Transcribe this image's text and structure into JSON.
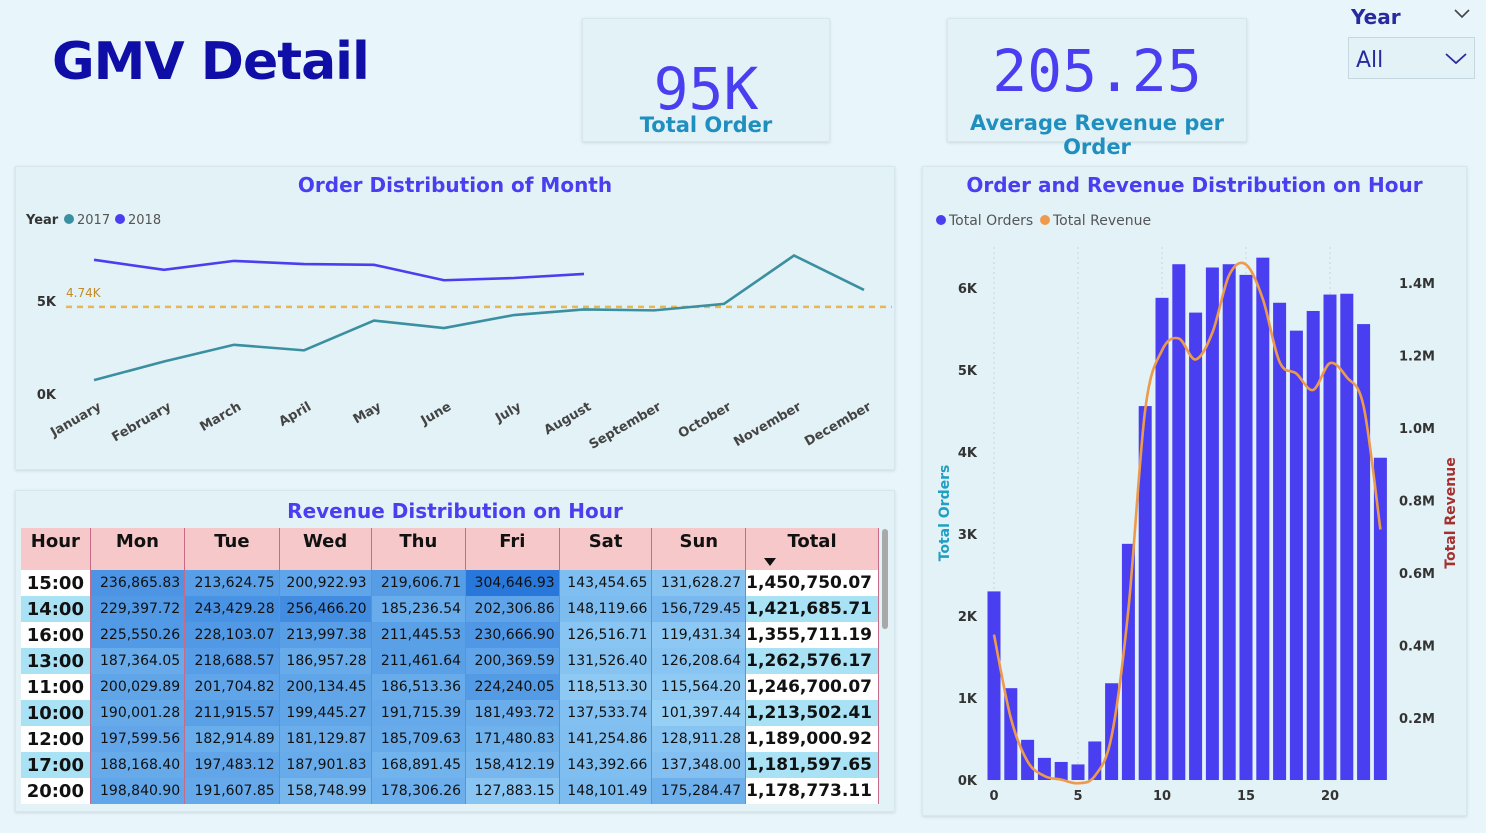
{
  "page_title": "GMV Detail",
  "kpis": {
    "total_order_value": "95K",
    "total_order_label": "Total Order",
    "avg_revenue_value": "205.25",
    "avg_revenue_label": "Average Revenue per Order"
  },
  "slicer": {
    "title": "Year",
    "selected": "All"
  },
  "colors": {
    "series_2017": "#3a8fa0",
    "series_2018": "#4a3ff0",
    "bar": "#4a3ff0",
    "revenue_line": "#ee9a4d",
    "avg_line": "#e8b84f",
    "header_pink": "#f6c8c9",
    "title_blue": "#0f0fa8"
  },
  "month_chart": {
    "title": "Order Distribution of Month",
    "legend_title": "Year",
    "avg_label": "4.74K"
  },
  "hour_chart": {
    "title": "Order and Revenue Distribution on Hour",
    "left_axis_label": "Total Orders",
    "right_axis_label": "Total Revenue"
  },
  "matrix": {
    "title": "Revenue Distribution on Hour",
    "headers": [
      "Hour",
      "Mon",
      "Tue",
      "Wed",
      "Thu",
      "Fri",
      "Sat",
      "Sun",
      "Total"
    ],
    "rows": [
      [
        "15:00",
        "236,865.83",
        "213,624.75",
        "200,922.93",
        "219,606.71",
        "304,646.93",
        "143,454.65",
        "131,628.27",
        "1,450,750.07"
      ],
      [
        "14:00",
        "229,397.72",
        "243,429.28",
        "256,466.20",
        "185,236.54",
        "202,306.86",
        "148,119.66",
        "156,729.45",
        "1,421,685.71"
      ],
      [
        "16:00",
        "225,550.26",
        "228,103.07",
        "213,997.38",
        "211,445.53",
        "230,666.90",
        "126,516.71",
        "119,431.34",
        "1,355,711.19"
      ],
      [
        "13:00",
        "187,364.05",
        "218,688.57",
        "186,957.28",
        "211,461.64",
        "200,369.59",
        "131,526.40",
        "126,208.64",
        "1,262,576.17"
      ],
      [
        "11:00",
        "200,029.89",
        "201,704.82",
        "200,134.45",
        "186,513.36",
        "224,240.05",
        "118,513.30",
        "115,564.20",
        "1,246,700.07"
      ],
      [
        "10:00",
        "190,001.28",
        "211,915.57",
        "199,445.27",
        "191,715.39",
        "181,493.72",
        "137,533.74",
        "101,397.44",
        "1,213,502.41"
      ],
      [
        "12:00",
        "197,599.56",
        "182,914.89",
        "181,129.87",
        "185,709.63",
        "171,480.83",
        "141,254.86",
        "128,911.28",
        "1,189,000.92"
      ],
      [
        "17:00",
        "188,168.40",
        "197,483.12",
        "187,901.83",
        "168,891.45",
        "158,412.19",
        "143,392.66",
        "137,348.00",
        "1,181,597.65"
      ],
      [
        "20:00",
        "198,840.90",
        "191,607.85",
        "158,748.99",
        "178,306.26",
        "127,883.15",
        "148,101.49",
        "175,284.47",
        "1,178,773.11"
      ]
    ]
  },
  "chart_data": [
    {
      "type": "line",
      "title": "Order Distribution of Month",
      "legend_title": "Year",
      "legend_position": "top-left",
      "categories": [
        "January",
        "February",
        "March",
        "April",
        "May",
        "June",
        "July",
        "August",
        "September",
        "October",
        "November",
        "December"
      ],
      "y_ticks": [
        "0K",
        "5K"
      ],
      "ylim": [
        0,
        7500
      ],
      "reference_line": {
        "value": 4740,
        "label": "4.74K"
      },
      "series": [
        {
          "name": "2017",
          "values": [
            800,
            1800,
            2700,
            2400,
            4000,
            3600,
            4300,
            4600,
            4550,
            4900,
            7500,
            5650
          ]
        },
        {
          "name": "2018",
          "values": [
            7270,
            6730,
            7210,
            7040,
            7000,
            6170,
            6290,
            6510
          ]
        }
      ]
    },
    {
      "type": "bar",
      "title": "Order and Revenue Distribution on Hour",
      "legend_position": "top-left",
      "x": [
        0,
        1,
        2,
        3,
        4,
        5,
        6,
        7,
        8,
        9,
        10,
        11,
        12,
        13,
        14,
        15,
        16,
        17,
        18,
        19,
        20,
        21,
        22,
        23
      ],
      "x_ticks": [
        0,
        5,
        10,
        15,
        20
      ],
      "y_left_ticks": [
        "0K",
        "1K",
        "2K",
        "3K",
        "4K",
        "5K",
        "6K"
      ],
      "y_right_ticks": [
        "0.2M",
        "0.4M",
        "0.6M",
        "0.8M",
        "1.0M",
        "1.2M",
        "1.4M"
      ],
      "ylim_left": [
        0,
        6500
      ],
      "ylim_right": [
        0,
        1510000
      ],
      "series": [
        {
          "name": "Total Orders",
          "kind": "bar",
          "axis": "left",
          "values": [
            2300,
            1120,
            490,
            270,
            220,
            190,
            470,
            1180,
            2880,
            4560,
            5880,
            6290,
            5700,
            6250,
            6290,
            6160,
            6370,
            5820,
            5480,
            5720,
            5920,
            5930,
            5560,
            3930
          ]
        },
        {
          "name": "Total Revenue",
          "kind": "line",
          "axis": "right",
          "values": [
            430000,
            200000,
            80000,
            40000,
            30000,
            20000,
            40000,
            150000,
            500000,
            1050000,
            1214000,
            1247000,
            1189000,
            1263000,
            1422000,
            1451000,
            1356000,
            1182000,
            1150000,
            1105000,
            1179000,
            1140000,
            1060000,
            720000
          ]
        }
      ]
    }
  ]
}
